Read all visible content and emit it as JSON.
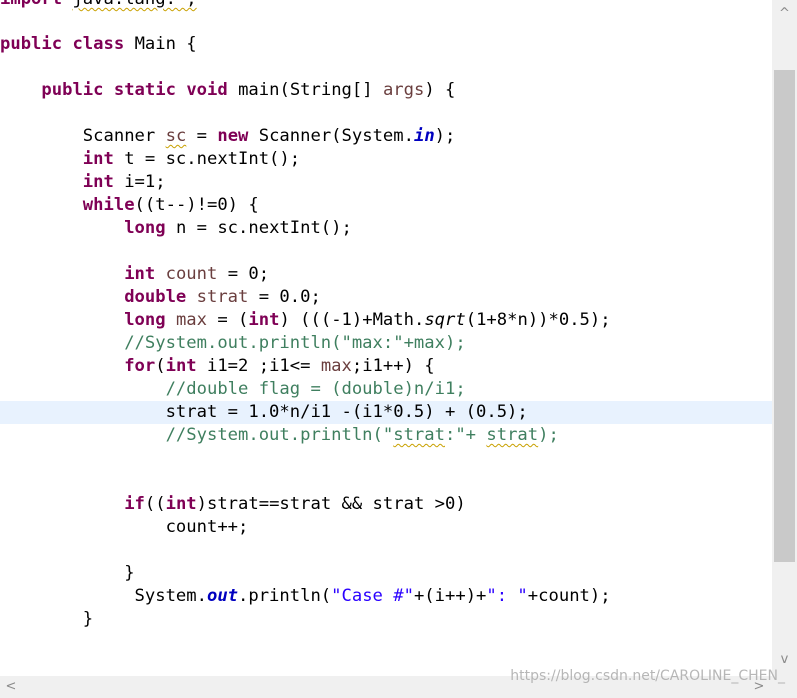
{
  "editor": {
    "line_import": {
      "kw": "import",
      "pkg": "java.lang.*;"
    },
    "line_class": {
      "kw1": "public",
      "kw2": "class",
      "name": "Main {"
    },
    "line_main": {
      "kw1": "public",
      "kw2": "static",
      "kw3": "void",
      "sig": "main(String[] ",
      "param": "args",
      "end": ") {"
    },
    "line_scanner": {
      "pre": "Scanner ",
      "var": "sc",
      "eq": " = ",
      "kw": "new",
      "post": " Scanner(System.",
      "field": "in",
      "end": ");"
    },
    "line_int_t": {
      "kw": "int",
      "post": " t = sc.nextInt();"
    },
    "line_int_i": {
      "kw": "int",
      "post": " i=1;"
    },
    "line_while": {
      "kw": "while",
      "post": "((t--)!=0) {"
    },
    "line_long_n": {
      "kw": "long",
      "post": " n = sc.nextInt();"
    },
    "line_count": {
      "kw": "int",
      "var": "count",
      "post": " = 0;"
    },
    "line_strat": {
      "kw": "double",
      "var": "strat",
      "post": " = 0.0;"
    },
    "line_max": {
      "kw": "long",
      "var": "max",
      "mid": " = (",
      "kw2": "int",
      "post1": ") (((-1)+Math.",
      "method": "sqrt",
      "post2": "(1+8*n))*0.5);"
    },
    "line_comment_max": "//System.out.println(\"max:\"+max);",
    "line_for": {
      "kw": "for",
      "open": "(",
      "kw2": "int",
      "post1": " i1=2 ;i1<= ",
      "var": "max",
      "post2": ";i1++) {"
    },
    "line_comment_flag": "//double flag = (double)n/i1;",
    "line_strat_assign": "strat = 1.0*n/i1 -(i1*0.5) + (0.5);",
    "line_comment_strat": {
      "pre": "//System.out.println(\"",
      "squig1": "strat",
      "mid": ":\"+ ",
      "squig2": "strat",
      "end": ");"
    },
    "line_if": {
      "kw": "if",
      "open": "((",
      "kw2": "int",
      "post": ")strat==strat && strat >0)"
    },
    "line_count_inc": "count++;",
    "line_close_for": "}",
    "line_println": {
      "pre": "System.",
      "field": "out",
      "mid": ".println(",
      "str1": "\"Case #\"",
      "mid2": "+(i++)+",
      "str2": "\": \"",
      "end": "+count);"
    },
    "line_close_while": "}"
  },
  "scrollbars": {
    "up_arrow": "^",
    "down_arrow": "v",
    "left_arrow": "<",
    "right_arrow": ">"
  },
  "watermark": "https://blog.csdn.net/CAROLINE_CHEN_"
}
